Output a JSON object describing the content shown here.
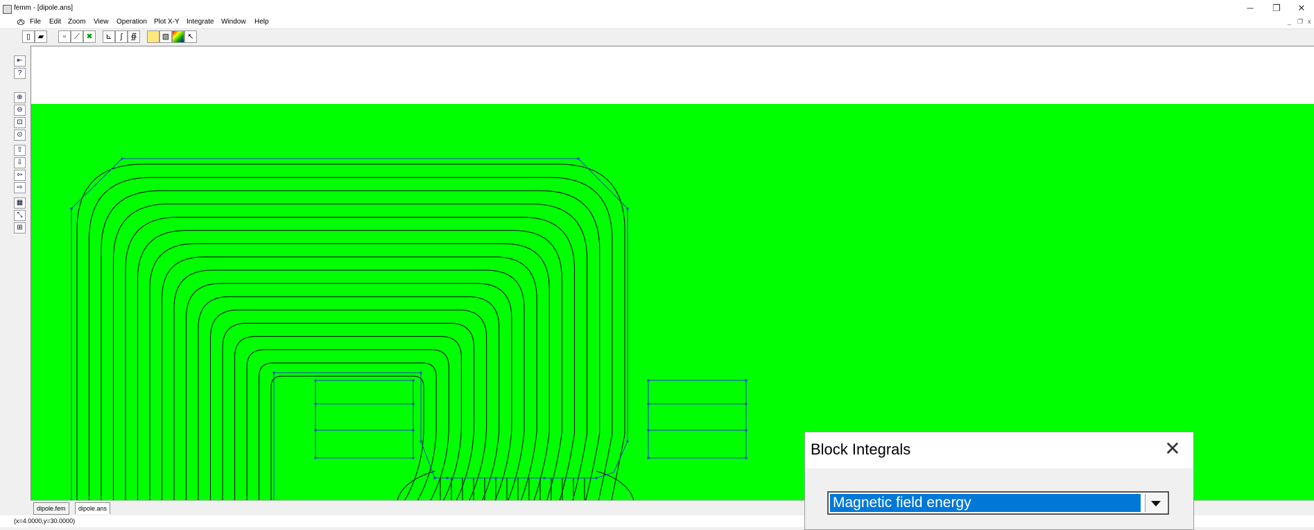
{
  "window": {
    "title": "femm - [dipole.ans]",
    "minimize": "─",
    "restore": "❐",
    "close": "✕"
  },
  "menu": {
    "items": [
      "File",
      "Edit",
      "Zoom",
      "View",
      "Operation",
      "Plot X-Y",
      "Integrate",
      "Window",
      "Help"
    ],
    "mdi_min": "_",
    "mdi_restore": "❐",
    "mdi_close": "x"
  },
  "toolbar": {
    "icons": [
      "new-file",
      "open-file",
      "point-mode",
      "contour-mode",
      "area-mode",
      "plot-xy",
      "line-integral",
      "block-integral",
      "density-plot",
      "flux-density-plot",
      "contour-plot",
      "select-pointer"
    ]
  },
  "left_toolbar": {
    "icons": [
      "previous-view",
      "help",
      "zoom-in",
      "zoom-out",
      "zoom-window",
      "zoom-natural",
      "pan-up",
      "pan-down",
      "pan-left",
      "pan-right",
      "grid",
      "snap-grid",
      "mesh"
    ]
  },
  "colors": {
    "region_fill": "#00ff00",
    "geometry": "#1f3fcf",
    "flux_lines": "#000000",
    "selection": "#0078d7"
  },
  "tabs": [
    "dipole.fem",
    "dipole.ans"
  ],
  "status": {
    "coordinates": "(x=4.0000,y=30.0000)"
  },
  "dialog": {
    "title": "Block Integrals",
    "close": "✕",
    "selected": "Magnetic field energy"
  }
}
